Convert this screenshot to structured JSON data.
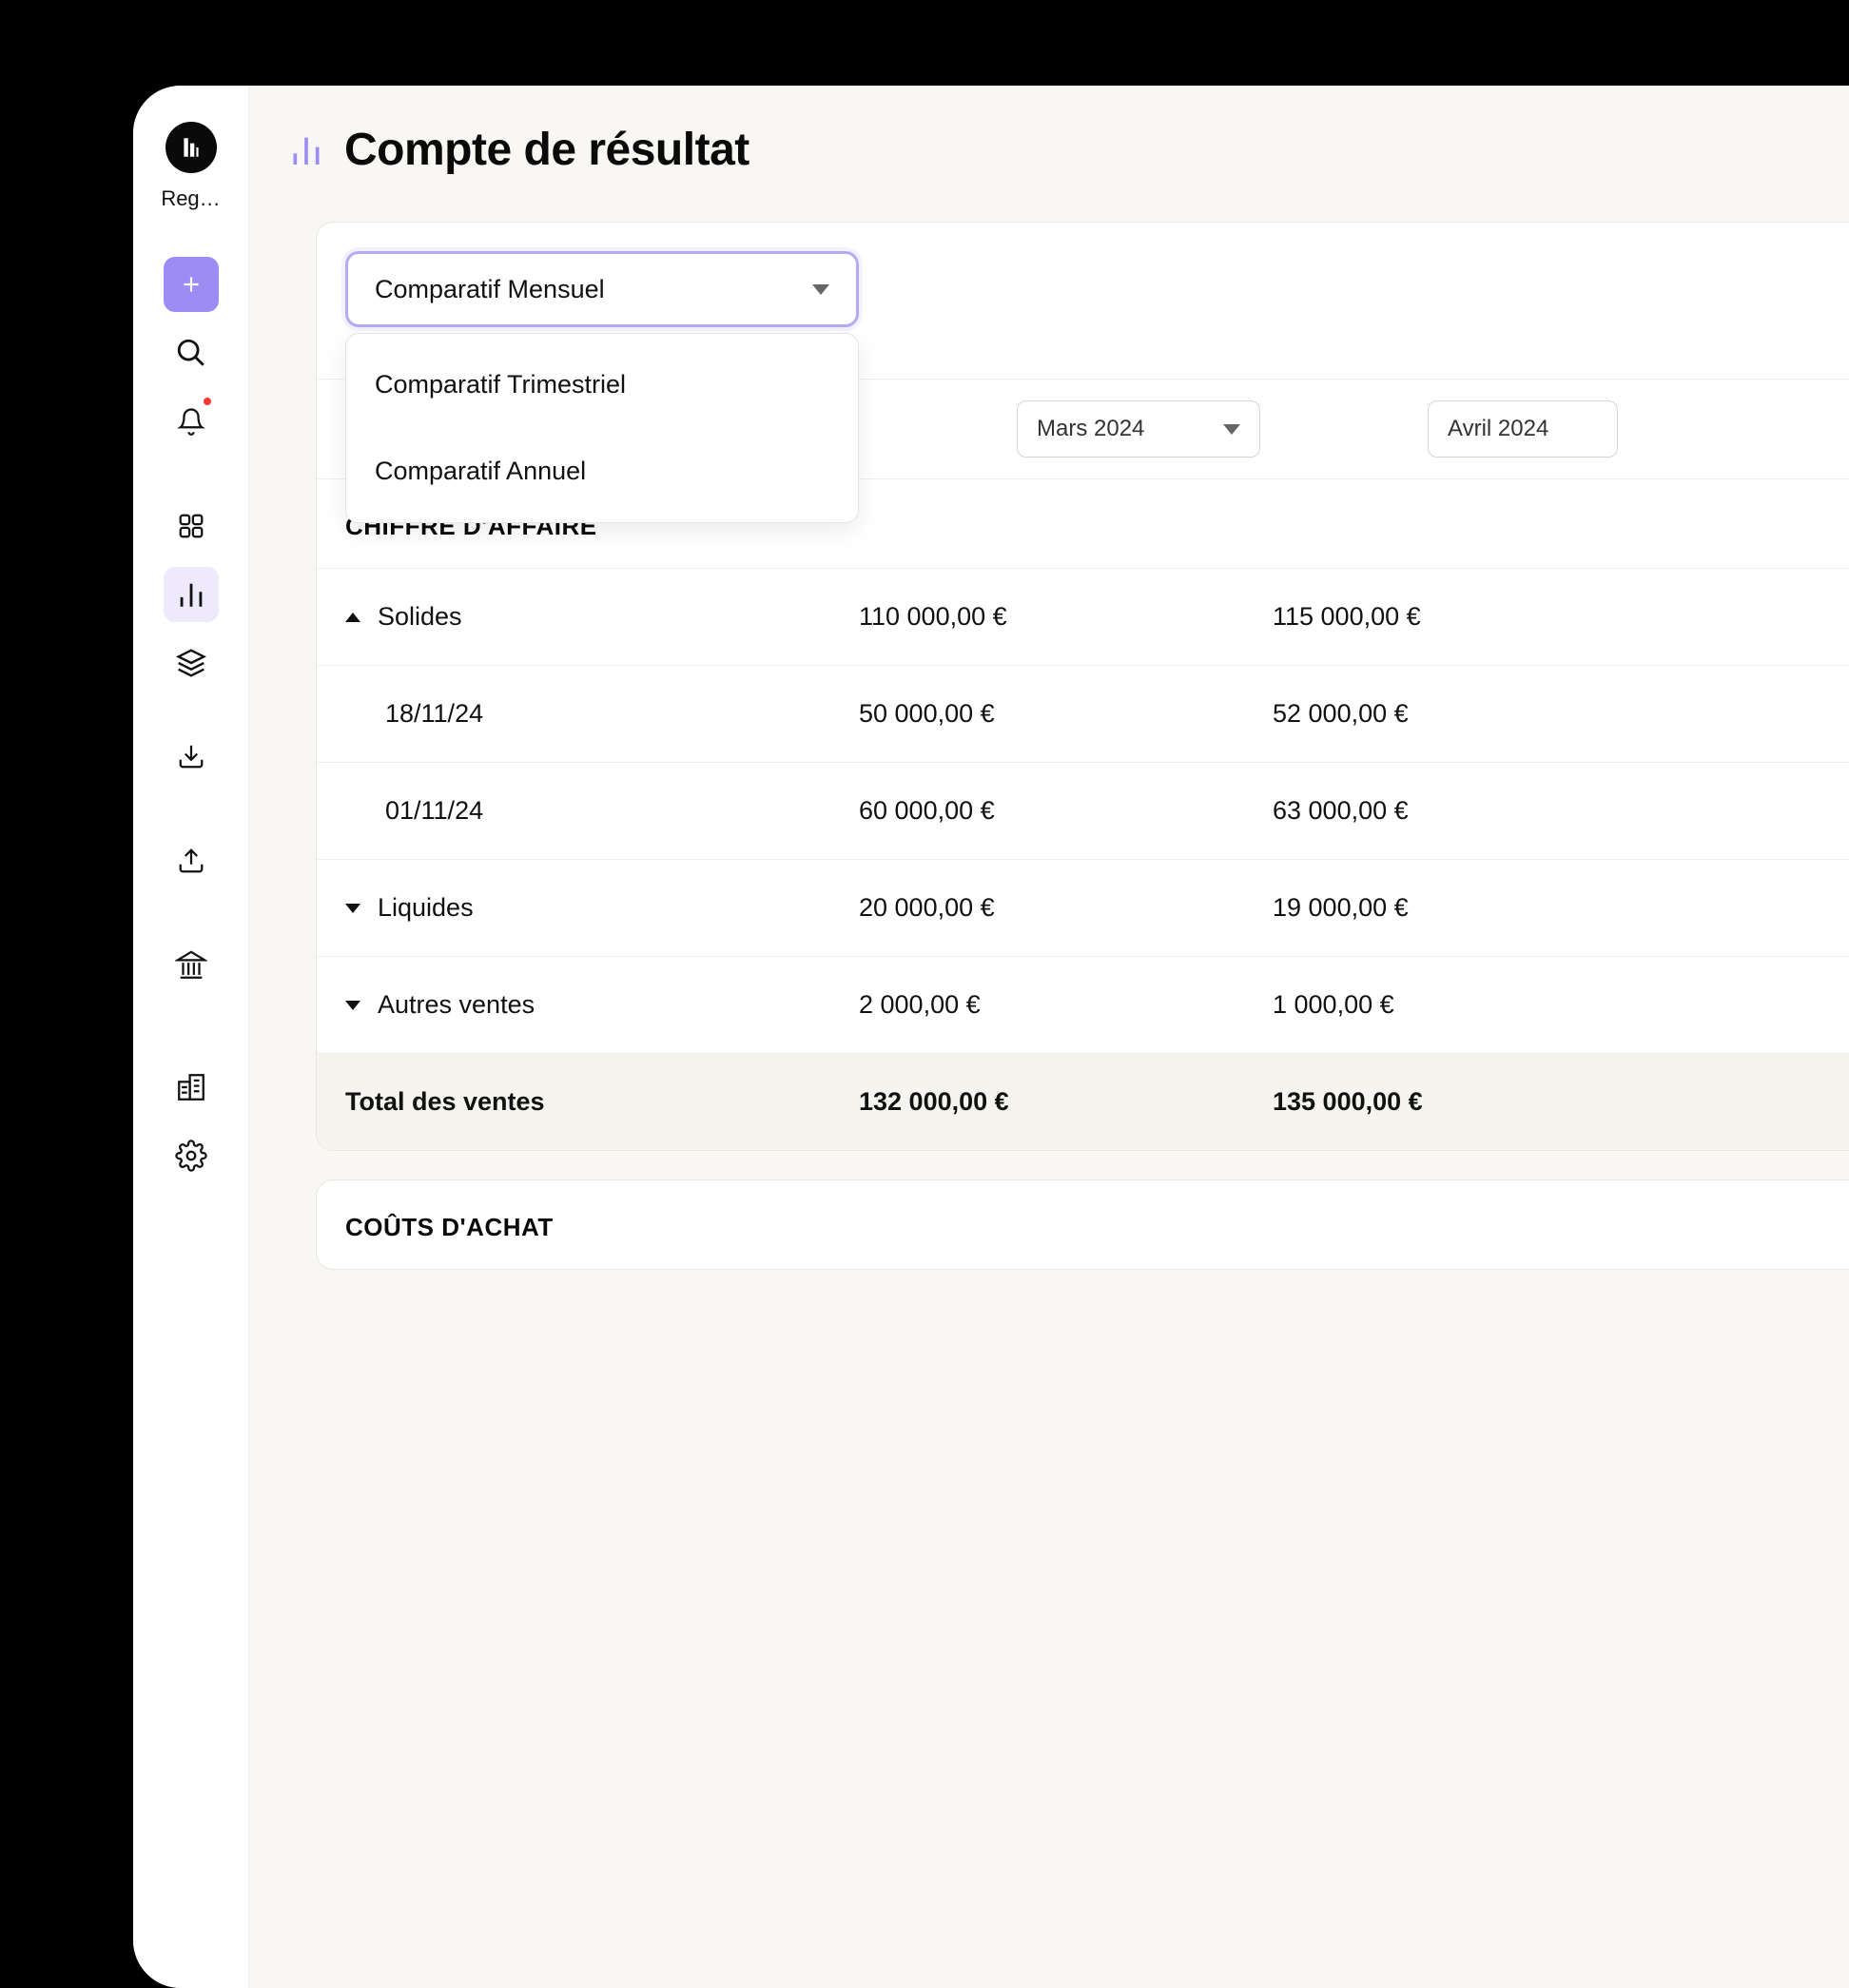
{
  "sidebar": {
    "org_label": "Reg…"
  },
  "header": {
    "title": "Compte de résultat"
  },
  "comparator": {
    "selected": "Comparatif Mensuel",
    "options": [
      "Comparatif Trimestriel",
      "Comparatif Annuel"
    ]
  },
  "periods": {
    "col1": "Mars 2024",
    "col2": "Avril 2024"
  },
  "sections": {
    "revenue": {
      "title": "CHIFFRE D'AFFAIRE",
      "rows": [
        {
          "label": "Solides",
          "v1": "110 000,00 €",
          "v2": "115 000,00 €",
          "expandable": true,
          "expanded": true
        },
        {
          "label": "18/11/24",
          "v1": "50 000,00 €",
          "v2": "52 000,00 €",
          "sub": true
        },
        {
          "label": "01/11/24",
          "v1": "60 000,00 €",
          "v2": "63 000,00 €",
          "sub": true
        },
        {
          "label": "Liquides",
          "v1": "20 000,00 €",
          "v2": "19 000,00 €",
          "expandable": true,
          "expanded": false
        },
        {
          "label": "Autres ventes",
          "v1": "2 000,00 €",
          "v2": "1 000,00 €",
          "expandable": true,
          "expanded": false
        }
      ],
      "total": {
        "label": "Total des ventes",
        "v1": "132 000,00 €",
        "v2": "135 000,00 €"
      }
    },
    "costs": {
      "title": "COÛTS D'ACHAT"
    }
  }
}
